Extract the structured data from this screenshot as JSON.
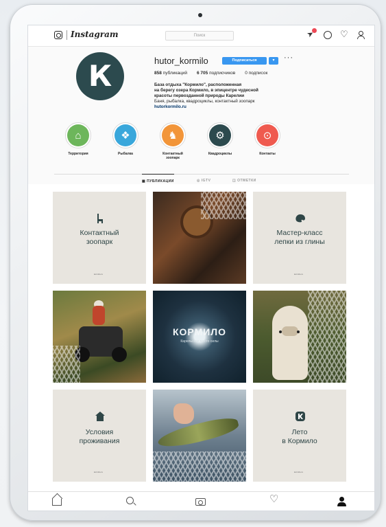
{
  "app": {
    "wordmark": "Instagram"
  },
  "search": {
    "placeholder": "Поиск",
    "icon": "search-icon"
  },
  "nav": {
    "icons": [
      "direct-icon",
      "compass-icon",
      "heart-icon",
      "user-icon"
    ]
  },
  "profile": {
    "username": "hutor_kormilo",
    "avatar_letter": "К",
    "follow_label": "Подписаться",
    "dropdown_glyph": "▾",
    "more_glyph": "···",
    "stats": {
      "posts": "858",
      "posts_label": "публикаций",
      "followers": "6 705",
      "followers_label": "подписчиков",
      "following": "0",
      "following_label": "подписок"
    },
    "bio": {
      "line1": "База отдыха \"Кормило\", расположенная",
      "line2": "на берегу озера Кормило, в эпицентре чудесной",
      "line3": "красоты первозданной природы Карелии",
      "line4": "Баня, рыбалка, квадроциклы, контактный зоопарк",
      "link": "hutorkormilo.ru"
    }
  },
  "highlights": [
    {
      "label": "Территория",
      "color": "#6db65b",
      "icon": "house-icon",
      "glyph": "⌂"
    },
    {
      "label": "Рыбалка",
      "color": "#39a7db",
      "icon": "fish-icon",
      "glyph": "❖"
    },
    {
      "label": "Контактный зоопарк",
      "color": "#f29539",
      "icon": "llama-icon",
      "glyph": "♞"
    },
    {
      "label": "Квадроциклы",
      "color": "#2c4a4e",
      "icon": "atv-icon",
      "glyph": "⚙"
    },
    {
      "label": "Контакты",
      "color": "#ef5a4f",
      "icon": "location-pin-icon",
      "glyph": "⊙"
    }
  ],
  "tabs": [
    {
      "label": "▦ ПУБЛИКАЦИИ",
      "active": true
    },
    {
      "label": "◎ IGTV",
      "active": false
    },
    {
      "label": "◫ ОТМЕТКИ",
      "active": false
    }
  ],
  "posts": {
    "p1": {
      "title_line1": "Контактный",
      "title_line2": "зоопарк",
      "icon": "llama-icon",
      "small": "kormilo.ru"
    },
    "p3": {
      "title_line1": "Мастер-класс",
      "title_line2": "лепки из глины",
      "icon": "palette-icon",
      "small": "kormilo.ru"
    },
    "p5": {
      "wordmark": "КОРМИЛО",
      "sub": "Карельское место силы"
    },
    "p7": {
      "title_line1": "Условия",
      "title_line2": "проживания",
      "icon": "house-icon",
      "small": "kormilo.ru"
    },
    "p9": {
      "title_line1": "Лето",
      "title_line2": "в Кормило",
      "icon": "logo-icon",
      "small": "kormilo.ru"
    }
  },
  "bottom_nav": [
    "home-icon",
    "search-icon",
    "camera-icon",
    "heart-icon",
    "profile-icon"
  ],
  "colors": {
    "accent": "#3897f0",
    "brand": "#2c4a4e",
    "notification": "#ed4956"
  }
}
